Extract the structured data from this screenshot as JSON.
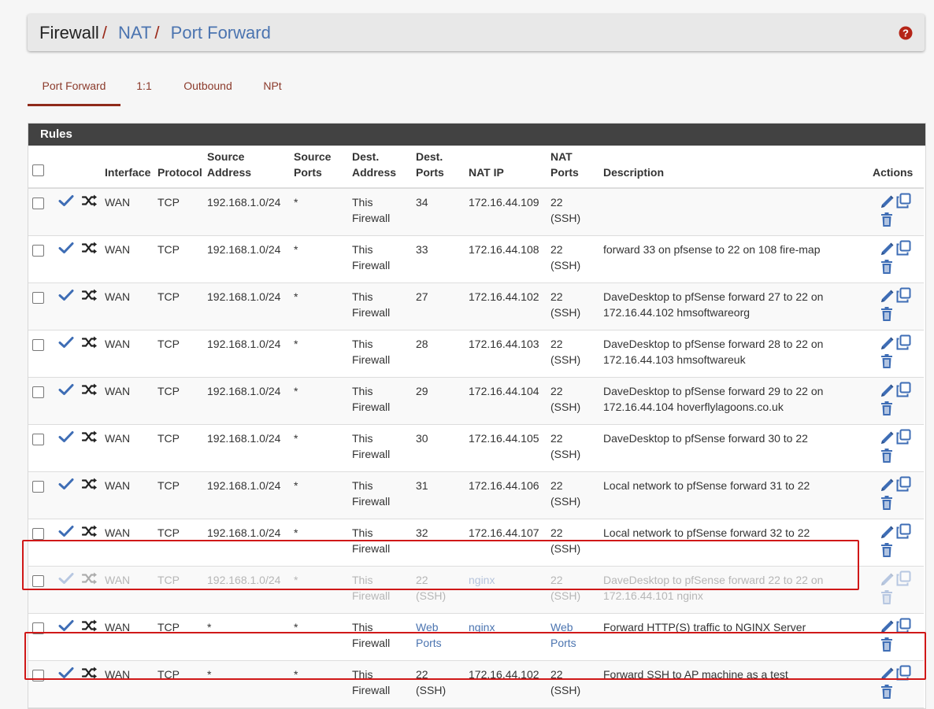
{
  "breadcrumb": {
    "root": "Firewall",
    "sep": "/",
    "nat": "NAT",
    "current": "Port Forward"
  },
  "tabs": [
    {
      "label": "Port Forward",
      "active": true
    },
    {
      "label": "1:1",
      "active": false
    },
    {
      "label": "Outbound",
      "active": false
    },
    {
      "label": "NPt",
      "active": false
    }
  ],
  "panel": {
    "title": "Rules"
  },
  "columns": {
    "interface": "Interface",
    "protocol": "Protocol",
    "source_address": "Source Address",
    "source_ports": "Source Ports",
    "dest_address": "Dest. Address",
    "dest_ports": "Dest. Ports",
    "nat_ip": "NAT IP",
    "nat_ports": "NAT Ports",
    "description": "Description",
    "actions": "Actions"
  },
  "rows": [
    {
      "interface": "WAN",
      "protocol": "TCP",
      "source_address": "192.168.1.0/24",
      "source_ports": "*",
      "dest_address": "This Firewall",
      "dest_ports": "34",
      "nat_ip": "172.16.44.109",
      "nat_ports": "22 (SSH)",
      "description": ""
    },
    {
      "interface": "WAN",
      "protocol": "TCP",
      "source_address": "192.168.1.0/24",
      "source_ports": "*",
      "dest_address": "This Firewall",
      "dest_ports": "33",
      "nat_ip": "172.16.44.108",
      "nat_ports": "22 (SSH)",
      "description": "forward 33 on pfsense to 22 on 108 fire-map"
    },
    {
      "interface": "WAN",
      "protocol": "TCP",
      "source_address": "192.168.1.0/24",
      "source_ports": "*",
      "dest_address": "This Firewall",
      "dest_ports": "27",
      "nat_ip": "172.16.44.102",
      "nat_ports": "22 (SSH)",
      "description": "DaveDesktop to pfSense forward 27 to 22 on 172.16.44.102 hmsoftwareorg"
    },
    {
      "interface": "WAN",
      "protocol": "TCP",
      "source_address": "192.168.1.0/24",
      "source_ports": "*",
      "dest_address": "This Firewall",
      "dest_ports": "28",
      "nat_ip": "172.16.44.103",
      "nat_ports": "22 (SSH)",
      "description": "DaveDesktop to pfSense forward 28 to 22 on 172.16.44.103 hmsoftwareuk"
    },
    {
      "interface": "WAN",
      "protocol": "TCP",
      "source_address": "192.168.1.0/24",
      "source_ports": "*",
      "dest_address": "This Firewall",
      "dest_ports": "29",
      "nat_ip": "172.16.44.104",
      "nat_ports": "22 (SSH)",
      "description": "DaveDesktop to pfSense forward 29 to 22 on 172.16.44.104 hoverflylagoons.co.uk"
    },
    {
      "interface": "WAN",
      "protocol": "TCP",
      "source_address": "192.168.1.0/24",
      "source_ports": "*",
      "dest_address": "This Firewall",
      "dest_ports": "30",
      "nat_ip": "172.16.44.105",
      "nat_ports": "22 (SSH)",
      "description": "DaveDesktop to pfSense forward 30 to 22"
    },
    {
      "interface": "WAN",
      "protocol": "TCP",
      "source_address": "192.168.1.0/24",
      "source_ports": "*",
      "dest_address": "This Firewall",
      "dest_ports": "31",
      "nat_ip": "172.16.44.106",
      "nat_ports": "22 (SSH)",
      "description": "Local network to pfSense forward 31 to 22"
    },
    {
      "interface": "WAN",
      "protocol": "TCP",
      "source_address": "192.168.1.0/24",
      "source_ports": "*",
      "dest_address": "This Firewall",
      "dest_ports": "32",
      "nat_ip": "172.16.44.107",
      "nat_ports": "22 (SSH)",
      "description": "Local network to pfSense forward 32 to 22"
    },
    {
      "interface": "WAN",
      "protocol": "TCP",
      "source_address": "192.168.1.0/24",
      "source_ports": "*",
      "dest_address": "This Firewall",
      "dest_ports": "22 (SSH)",
      "nat_ip": "nginx",
      "nat_ports": "22 (SSH)",
      "description": "DaveDesktop to pfSense forward 22 to 22 on 172.16.44.101 nginx"
    },
    {
      "interface": "WAN",
      "protocol": "TCP",
      "source_address": "*",
      "source_ports": "*",
      "dest_address": "This Firewall",
      "dest_ports": "Web_ Ports",
      "nat_ip": "nginx",
      "nat_ports": "Web_ Ports",
      "description": "Forward HTTP(S) traffic to NGINX Server"
    },
    {
      "interface": "WAN",
      "protocol": "TCP",
      "source_address": "*",
      "source_ports": "*",
      "dest_address": "This Firewall",
      "dest_ports": "22 (SSH)",
      "nat_ip": "172.16.44.102",
      "nat_ports": "22 (SSH)",
      "description": "Forward SSH to AP machine as a test"
    }
  ],
  "icons": {
    "help": "question-circle-icon",
    "enabled": "check-icon",
    "nat_reflection": "shuffle-icon",
    "edit": "pencil-icon",
    "copy": "copy-icon",
    "delete": "trash-icon"
  },
  "colors": {
    "header_bg": "#424242",
    "link": "#4b74b0",
    "accent": "#8f2a1a",
    "highlight": "#d01818"
  }
}
